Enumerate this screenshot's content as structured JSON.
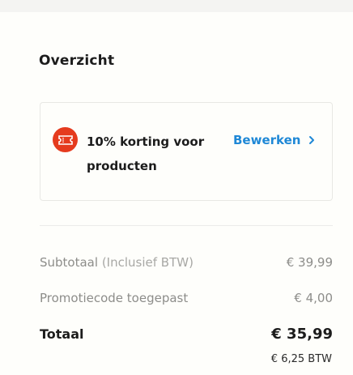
{
  "overview": {
    "title": "Overzicht"
  },
  "promo": {
    "icon": "ticket-icon",
    "line1": "10% korting voor",
    "line2": "producten",
    "edit_label": "Bewerken"
  },
  "summary": {
    "subtotal_label": "Subtotaal",
    "subtotal_note": "(Inclusief BTW)",
    "subtotal_value": "€ 39,99",
    "promo_label": "Promotiecode toegepast",
    "promo_value": "€ 4,00",
    "total_label": "Totaal",
    "total_value": "€ 35,99",
    "vat_value": "€ 6,25 BTW"
  },
  "colors": {
    "accent": "#1f88d6",
    "promo_badge": "#e53b1e"
  }
}
